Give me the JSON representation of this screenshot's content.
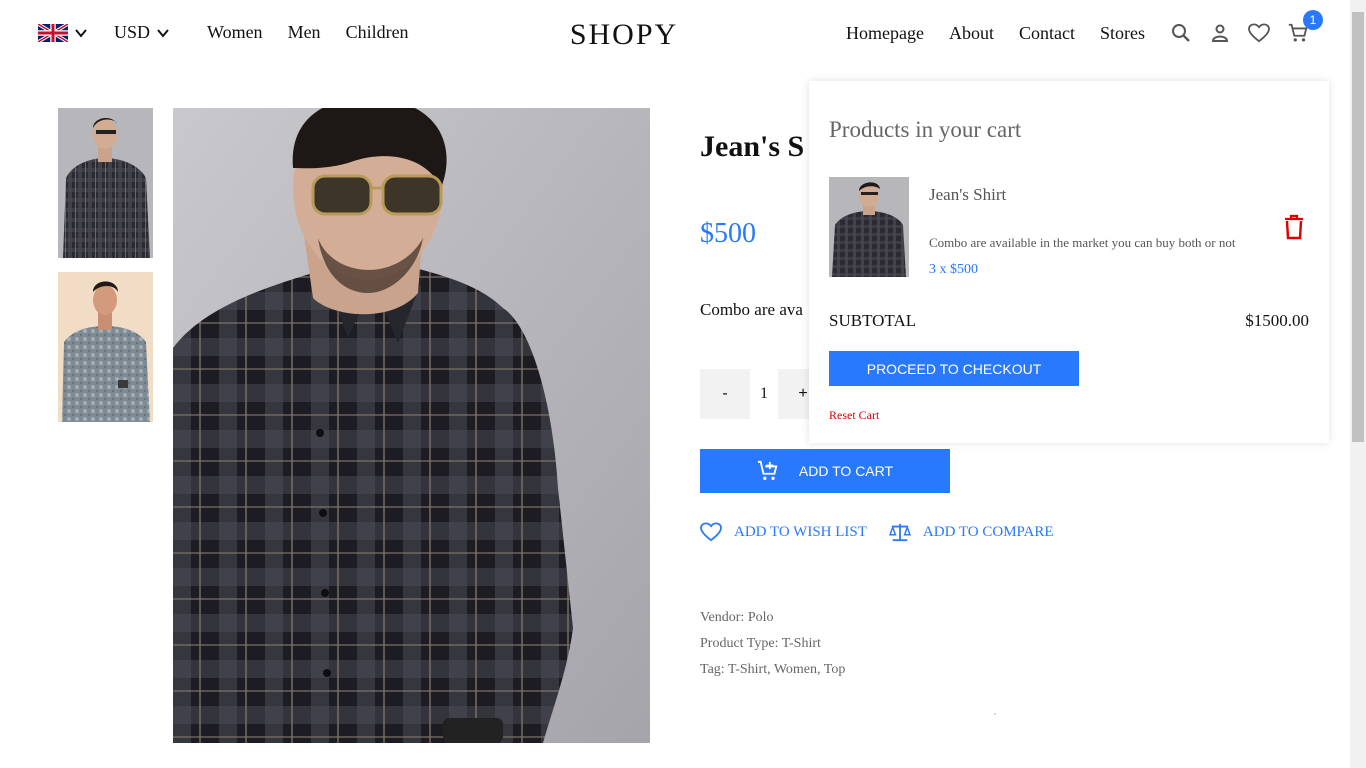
{
  "header": {
    "currency": "USD",
    "nav_left": [
      "Women",
      "Men",
      "Children"
    ],
    "logo": "SHOPY",
    "nav_right": [
      "Homepage",
      "About",
      "Contact",
      "Stores"
    ],
    "cart_count": "1"
  },
  "product": {
    "title": "Jean's S",
    "price": "$500",
    "description": "Combo are ava",
    "qty_minus": "-",
    "qty_value": "1",
    "qty_plus": "+",
    "add_to_cart": "ADD TO CART",
    "add_to_wishlist": "ADD TO WISH LIST",
    "add_to_compare": "ADD TO COMPARE",
    "vendor": "Vendor: Polo",
    "product_type": "Product Type: T-Shirt",
    "tags": "Tag: T-Shirt, Women, Top"
  },
  "cart": {
    "heading": "Products in your cart",
    "item_name": "Jean's Shirt",
    "item_desc": "Combo are available in the market you can buy both or not",
    "item_qty_price": "3 x $500",
    "subtotal_label": "SUBTOTAL",
    "subtotal_value": "$1500.00",
    "checkout_label": "PROCEED TO CHECKOUT",
    "reset_label": "Reset Cart"
  },
  "icons": {
    "language": "uk-flag-icon",
    "search": "search-icon",
    "account": "user-icon",
    "wishlist": "heart-icon",
    "cart": "cart-icon",
    "delete": "trash-icon",
    "compare": "balance-icon"
  },
  "colors": {
    "accent": "#2879fe",
    "danger": "#d00000"
  }
}
